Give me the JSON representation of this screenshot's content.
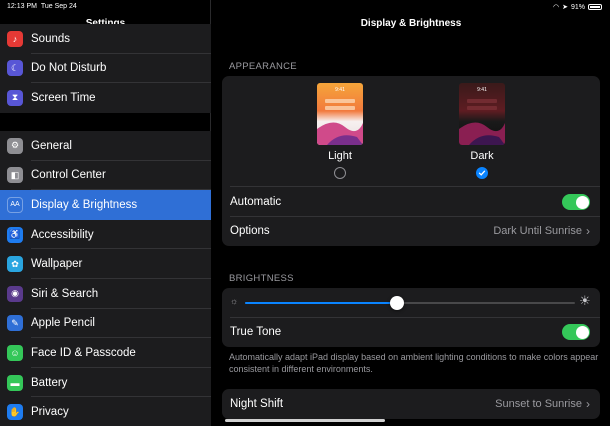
{
  "status": {
    "time": "12:13 PM",
    "date": "Tue Sep 24",
    "battery": "91%"
  },
  "sidebar": {
    "title": "Settings",
    "group1": [
      {
        "label": "Sounds",
        "icon": "speaker-icon",
        "glyph": "♪",
        "color": "#e53935"
      },
      {
        "label": "Do Not Disturb",
        "icon": "moon-icon",
        "glyph": "☾",
        "color": "#5856d6"
      },
      {
        "label": "Screen Time",
        "icon": "hourglass-icon",
        "glyph": "⧗",
        "color": "#5856d6"
      }
    ],
    "group2": [
      {
        "label": "General",
        "icon": "gear-icon",
        "glyph": "⚙",
        "color": "#8e8e93"
      },
      {
        "label": "Control Center",
        "icon": "toggles-icon",
        "glyph": "◧",
        "color": "#8e8e93"
      },
      {
        "label": "Display & Brightness",
        "icon": "text-size-icon",
        "glyph": "AA",
        "color": "#2f6fd6",
        "selected": true
      },
      {
        "label": "Accessibility",
        "icon": "accessibility-icon",
        "glyph": "♿",
        "color": "#1e7cf0"
      },
      {
        "label": "Wallpaper",
        "icon": "flower-icon",
        "glyph": "✿",
        "color": "#2aa5e0"
      },
      {
        "label": "Siri & Search",
        "icon": "siri-icon",
        "glyph": "◉",
        "color": "#5a3a8c"
      },
      {
        "label": "Apple Pencil",
        "icon": "pencil-icon",
        "glyph": "✎",
        "color": "#2f6fd6"
      },
      {
        "label": "Face ID & Passcode",
        "icon": "face-id-icon",
        "glyph": "☺",
        "color": "#34c759"
      },
      {
        "label": "Battery",
        "icon": "battery-icon",
        "glyph": "▬",
        "color": "#34c759"
      },
      {
        "label": "Privacy",
        "icon": "hand-icon",
        "glyph": "✋",
        "color": "#1e7cf0"
      }
    ]
  },
  "main": {
    "title": "Display & Brightness",
    "appearance": {
      "header": "APPEARANCE",
      "light_label": "Light",
      "dark_label": "Dark",
      "thumb_time": "9:41",
      "selected": "dark",
      "automatic_label": "Automatic",
      "automatic_on": true,
      "options_label": "Options",
      "options_value": "Dark Until Sunrise"
    },
    "brightness": {
      "header": "BRIGHTNESS",
      "level": 0.46,
      "true_tone_label": "True Tone",
      "true_tone_on": true,
      "description": "Automatically adapt iPad display based on ambient lighting conditions to make colors appear consistent in different environments."
    },
    "night_shift": {
      "label": "Night Shift",
      "value": "Sunset to Sunrise"
    }
  },
  "colors": {
    "accent": "#0a84ff",
    "toggle_on": "#34c759",
    "selected_row": "#2f6fd6"
  }
}
